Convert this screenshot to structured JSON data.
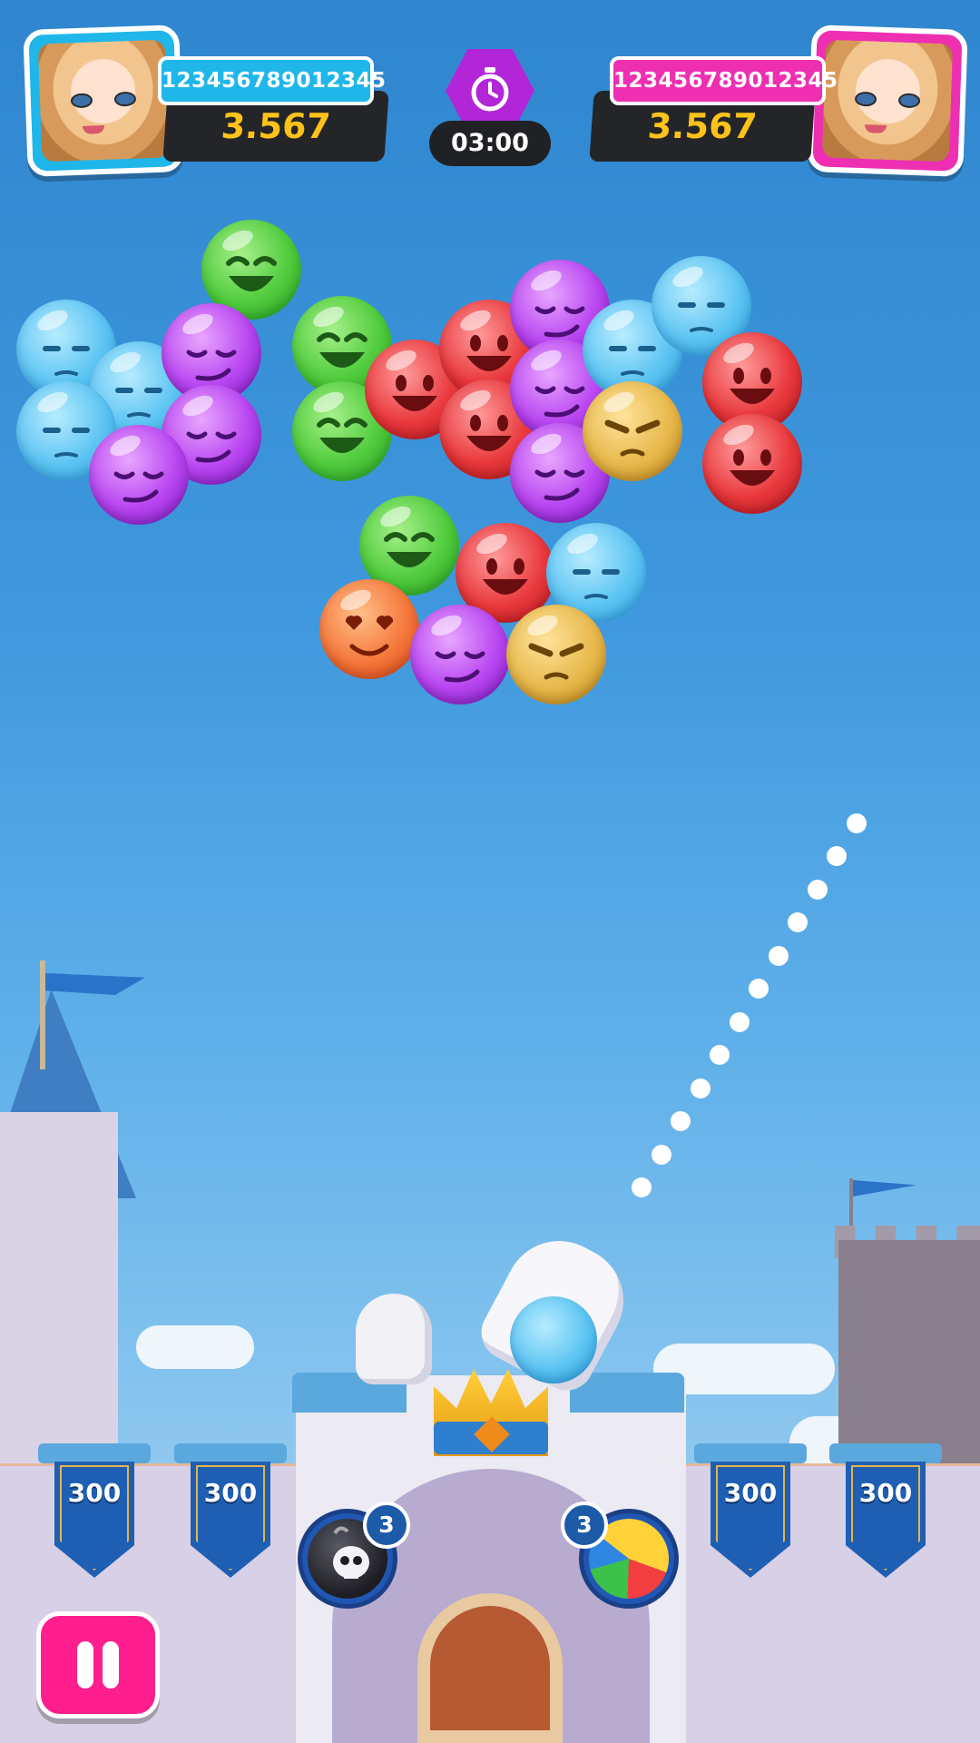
{
  "players": {
    "left": {
      "id": "123456789012345",
      "score": "3.567",
      "color": "#1fb6ea"
    },
    "right": {
      "id": "123456789012345",
      "score": "3.567",
      "color": "#ee2fb2"
    }
  },
  "timer": {
    "value": "03:00",
    "icon": "stopwatch-icon"
  },
  "bubble_colors": [
    "blue",
    "green",
    "purple",
    "red",
    "yellow",
    "orange"
  ],
  "banners": [
    {
      "value": "300"
    },
    {
      "value": "300"
    },
    {
      "value": "300"
    },
    {
      "value": "300"
    }
  ],
  "powerups": {
    "bomb": {
      "icon": "skull-bomb-icon",
      "count": "3"
    },
    "ball": {
      "icon": "beach-ball-icon",
      "count": "3"
    }
  },
  "loaded_bubble": "blue",
  "pause": {
    "icon": "pause-icon"
  }
}
